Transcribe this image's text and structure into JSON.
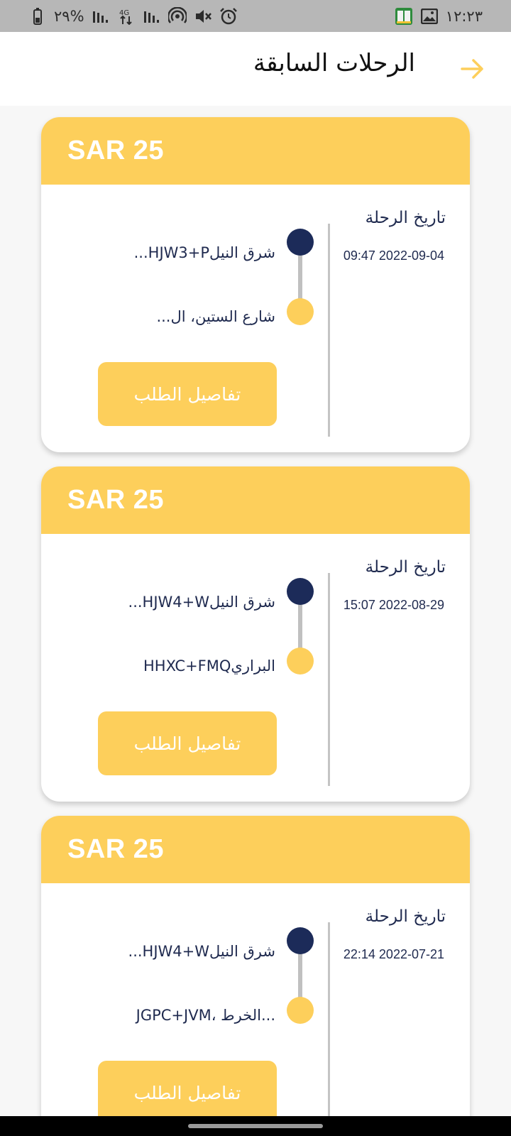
{
  "status_bar": {
    "time": "١٢:٢٣",
    "battery_percent": "٢٩%",
    "network_type": "4G",
    "left_icons": [
      "battery-icon",
      "signal-icon",
      "data-icon",
      "signal-icon",
      "hotspot-icon",
      "mute-icon",
      "alarm-icon"
    ],
    "right_icons": [
      "quran-app-icon",
      "gallery-icon"
    ]
  },
  "header": {
    "title": "الرحلات السابقة",
    "back_icon": "arrow-right-icon"
  },
  "colors": {
    "accent": "#fdcf5b",
    "dark_blue": "#1c2b59",
    "text": "#1f2a4f"
  },
  "trips": [
    {
      "price": "SAR 25",
      "date_label": "تاريخ الرحلة",
      "date": "09:47 2022-09-04",
      "from": "شرق النيلHJW3+P...",
      "to": "شارع الستين، ال...",
      "button_label": "تفاصيل الطلب"
    },
    {
      "price": "SAR 25",
      "date_label": "تاريخ الرحلة",
      "date": "15:07 2022-08-29",
      "from": "شرق النيلHJW4+W...",
      "to": "البراريHHXC+FMQ",
      "button_label": "تفاصيل الطلب"
    },
    {
      "price": "SAR 25",
      "date_label": "تاريخ الرحلة",
      "date": "22:14 2022-07-21",
      "from": "شرق النيلHJW4+W...",
      "to": "JGPC+JVM، الخرط...",
      "button_label": "تفاصيل الطلب"
    }
  ]
}
